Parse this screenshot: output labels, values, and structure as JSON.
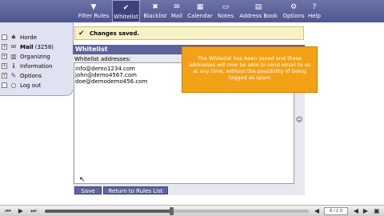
{
  "toolbar": {
    "items": [
      {
        "label": "Filter Rules",
        "icon": "filter-icon",
        "glyph": "▼"
      },
      {
        "label": "Whitelist",
        "icon": "whitelist-check-icon",
        "glyph": "✔",
        "active": true
      },
      {
        "label": "Blacklist",
        "icon": "blacklist-icon",
        "glyph": "✖"
      },
      {
        "label": "Mail",
        "icon": "mail-icon",
        "glyph": "✉"
      },
      {
        "label": "Calendar",
        "icon": "calendar-icon",
        "glyph": "▦"
      },
      {
        "label": "Notes",
        "icon": "notes-icon",
        "glyph": "▭"
      },
      {
        "label": "Address Book",
        "icon": "address-book-icon",
        "glyph": "▤"
      },
      {
        "label": "Options",
        "icon": "options-icon",
        "glyph": "⚙"
      },
      {
        "label": "Help",
        "icon": "help-icon",
        "glyph": "?"
      }
    ],
    "colors": {
      "background": "#5b6299",
      "active": "#3d4379"
    }
  },
  "sidebar": {
    "items": [
      {
        "label": "Horde",
        "icon": "horde-icon",
        "glyph": "♠"
      },
      {
        "label": "Mail",
        "count": "(3258)",
        "icon": "mail-icon",
        "glyph": "✉"
      },
      {
        "label": "Organizing",
        "icon": "organizing-icon",
        "glyph": "▥"
      },
      {
        "label": "Information",
        "icon": "information-icon",
        "glyph": "ℹ"
      },
      {
        "label": "Options",
        "icon": "options-icon",
        "glyph": "✎"
      },
      {
        "label": "Log out",
        "icon": "logout-icon",
        "glyph": "○"
      }
    ]
  },
  "notification": {
    "message": "Changes saved.",
    "icon": "checkmark-icon",
    "glyph": "✔"
  },
  "whitelist": {
    "title": "Whitelist",
    "field_label": "Whitelist addresses:",
    "addresses": [
      "info@demo1234.com",
      "john@demo4567.com",
      "doe@demodemo456.com"
    ]
  },
  "buttons": {
    "save": "Save",
    "return": "Return to Rules List"
  },
  "tooltip": {
    "text": "The Whitelist has been saved and these addresses will now be able to send email to us at any time, without the possibility of being tagged as spam",
    "color": "#f3a117"
  },
  "player": {
    "counter": "8 / 1 0",
    "progress": 0.48,
    "icons": {
      "rewind": "rewind-icon",
      "play": "play-icon",
      "forward": "forward-icon",
      "volume": "volume-icon",
      "fullscreen": "fullscreen-icon"
    }
  }
}
